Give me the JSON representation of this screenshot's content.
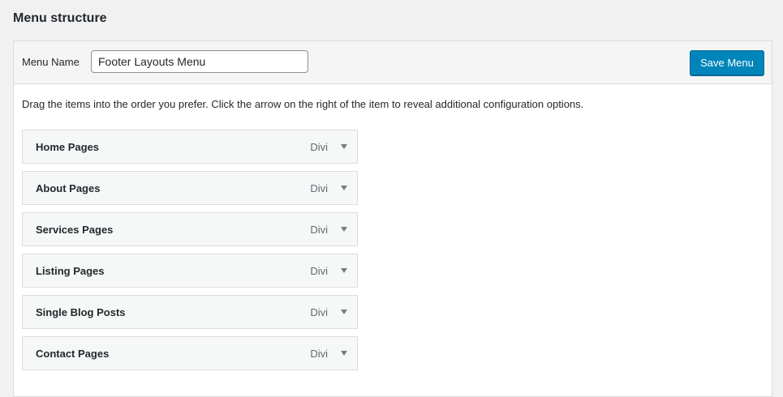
{
  "header": {
    "title": "Menu structure"
  },
  "menu_name": {
    "label": "Menu Name",
    "value": "Footer Layouts Menu"
  },
  "toolbar": {
    "save_label": "Save Menu"
  },
  "instructions": "Drag the items into the order you prefer. Click the arrow on the right of the item to reveal additional configuration options.",
  "menu_items": [
    {
      "title": "Home Pages",
      "type": "Divi"
    },
    {
      "title": "About Pages",
      "type": "Divi"
    },
    {
      "title": "Services Pages",
      "type": "Divi"
    },
    {
      "title": "Listing Pages",
      "type": "Divi"
    },
    {
      "title": "Single Blog Posts",
      "type": "Divi"
    },
    {
      "title": "Contact Pages",
      "type": "Divi"
    }
  ],
  "colors": {
    "accent": "#0085ba",
    "background": "#f1f1f1"
  },
  "icons": {
    "item_toggle": "triangle-down-icon"
  }
}
